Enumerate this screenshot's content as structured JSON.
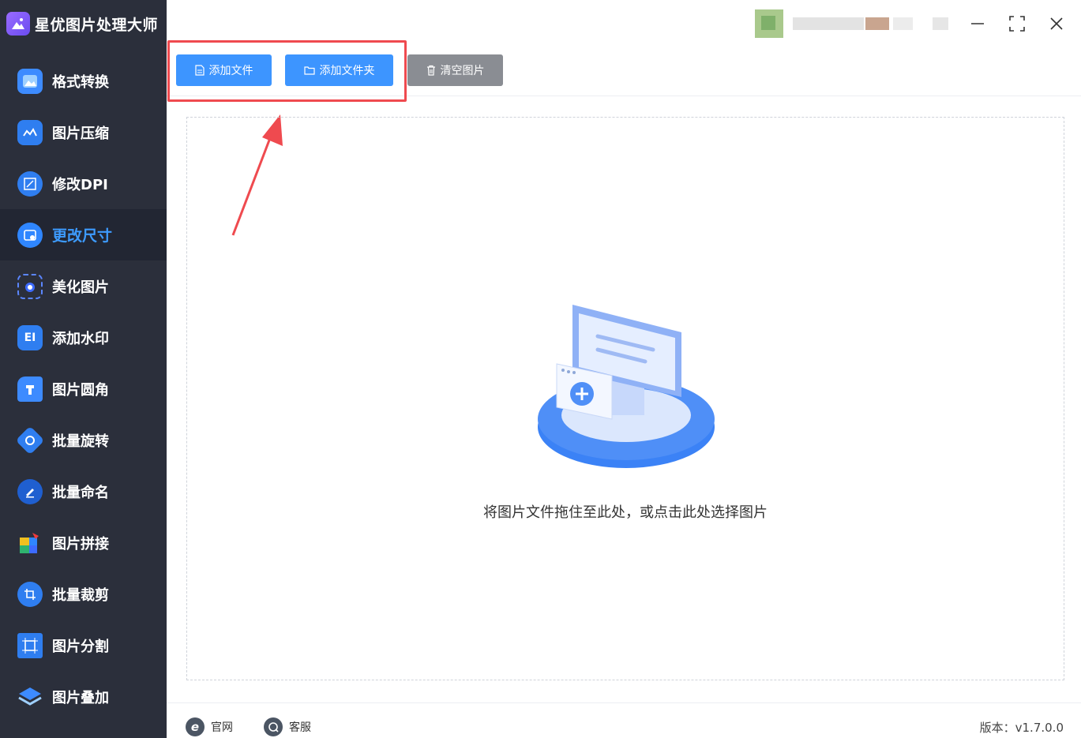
{
  "app": {
    "title": "星优图片处理大师"
  },
  "sidebar": {
    "items": [
      {
        "label": "格式转换",
        "icon": "image-convert-icon",
        "color": "#3d8bff"
      },
      {
        "label": "图片压缩",
        "icon": "image-compress-icon",
        "color": "#2f7ef0"
      },
      {
        "label": "修改DPI",
        "icon": "dpi-icon",
        "color": "#2f7ef0"
      },
      {
        "label": "更改尺寸",
        "icon": "resize-icon",
        "color": "#2f86ff",
        "active": true
      },
      {
        "label": "美化图片",
        "icon": "beautify-icon",
        "color": "#3d6bff"
      },
      {
        "label": "添加水印",
        "icon": "watermark-icon",
        "color": "#2f7ef0"
      },
      {
        "label": "图片圆角",
        "icon": "round-corner-icon",
        "color": "#3d8bff"
      },
      {
        "label": "批量旋转",
        "icon": "rotate-icon",
        "color": "#2f7ef0"
      },
      {
        "label": "批量命名",
        "icon": "rename-icon",
        "color": "#2f7ef0"
      },
      {
        "label": "图片拼接",
        "icon": "puzzle-icon",
        "color": "#f0a020"
      },
      {
        "label": "批量裁剪",
        "icon": "crop-icon",
        "color": "#2f7ef0"
      },
      {
        "label": "图片分割",
        "icon": "split-icon",
        "color": "#2f7ef0"
      },
      {
        "label": "图片叠加",
        "icon": "layers-icon",
        "color": "#3d8bff"
      }
    ]
  },
  "toolbar": {
    "add_file": "添加文件",
    "add_folder": "添加文件夹",
    "clear_images": "清空图片"
  },
  "dropzone": {
    "hint": "将图片文件拖住至此处，或点击此处选择图片"
  },
  "footer": {
    "website": "官网",
    "support": "客服",
    "version": "版本：v1.7.0.0"
  },
  "colors": {
    "accent": "#3d95ff",
    "sidebar_bg": "#2b2f3b",
    "highlight": "#ef4a4f"
  }
}
